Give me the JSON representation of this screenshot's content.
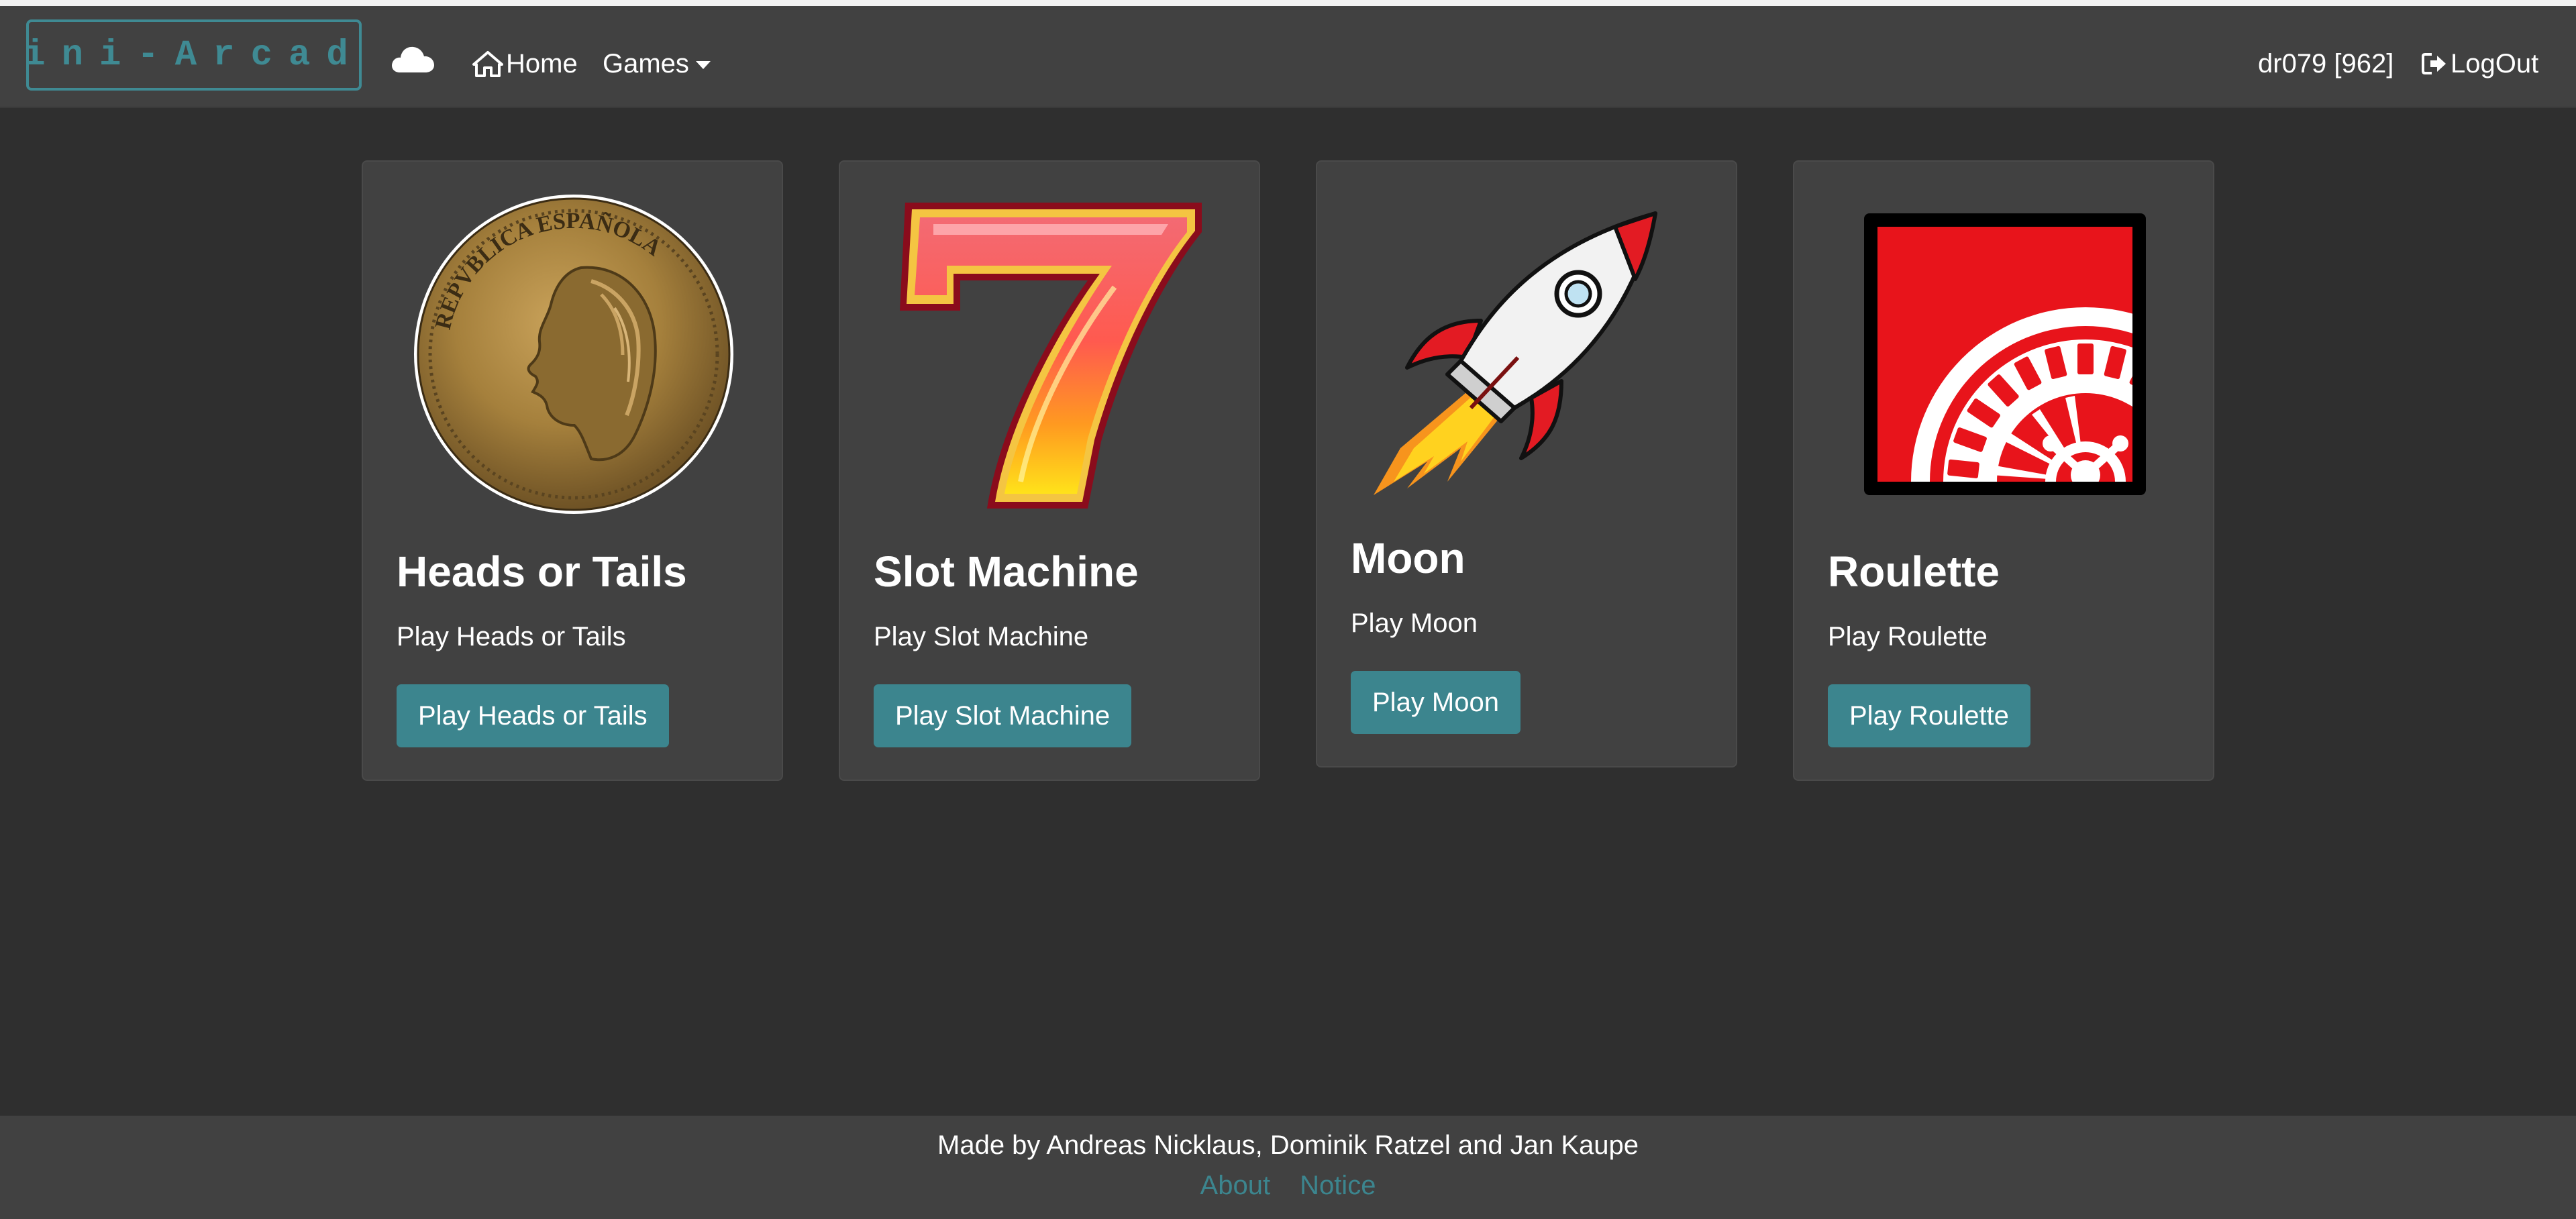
{
  "navbar": {
    "brand": "Mini-Arcade",
    "cloud_icon": "cloud-icon",
    "home_label": "Home",
    "home_icon": "home-icon",
    "games_label": "Games",
    "user_label": "dr079 [962]",
    "logout_label": "LogOut",
    "logout_icon": "sign-out-icon"
  },
  "games": [
    {
      "title": "Heads or Tails",
      "description": "Play Heads or Tails",
      "button": "Play Heads or Tails",
      "image": "coin-image",
      "coin_text": "REPVBLICA ESPAÑOLA"
    },
    {
      "title": "Slot Machine",
      "description": "Play Slot Machine",
      "button": "Play Slot Machine",
      "image": "lucky-seven-image"
    },
    {
      "title": "Moon",
      "description": "Play Moon",
      "button": "Play Moon",
      "image": "rocket-image"
    },
    {
      "title": "Roulette",
      "description": "Play Roulette",
      "button": "Play Roulette",
      "image": "roulette-wheel-image"
    }
  ],
  "footer": {
    "credit": "Made by Andreas Nicklaus, Dominik Ratzel and Jan Kaupe",
    "links": [
      "About",
      "Notice"
    ]
  },
  "colors": {
    "page_background": "#2f2f2f",
    "navbar_background": "#414141",
    "card_background": "#414141",
    "accent": "#3c858e",
    "roulette_red": "#e8141b"
  }
}
